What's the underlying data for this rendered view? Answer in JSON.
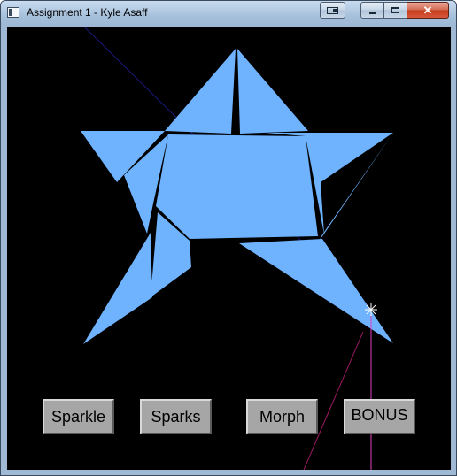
{
  "window": {
    "title": "Assignment 1 - Kyle Asaff",
    "close_glyph": "✕"
  },
  "icons": {
    "app": "application-icon",
    "snap": "snap-layout-icon",
    "minimize": "minimize-icon",
    "maximize": "maximize-icon",
    "close": "close-icon",
    "sparkle": "sparkle-star-icon"
  },
  "colors": {
    "canvas_background": "#000000",
    "star_fill": "#6fb3ff",
    "button_face": "#a6a6a6",
    "navy_line": "#1a1a80",
    "pink_line": "#e040c0",
    "crimson_line": "#9a1a60"
  },
  "buttons": {
    "sparkle": "Sparkle",
    "sparks": "Sparks",
    "morph": "Morph",
    "bonus": "BONUS"
  }
}
